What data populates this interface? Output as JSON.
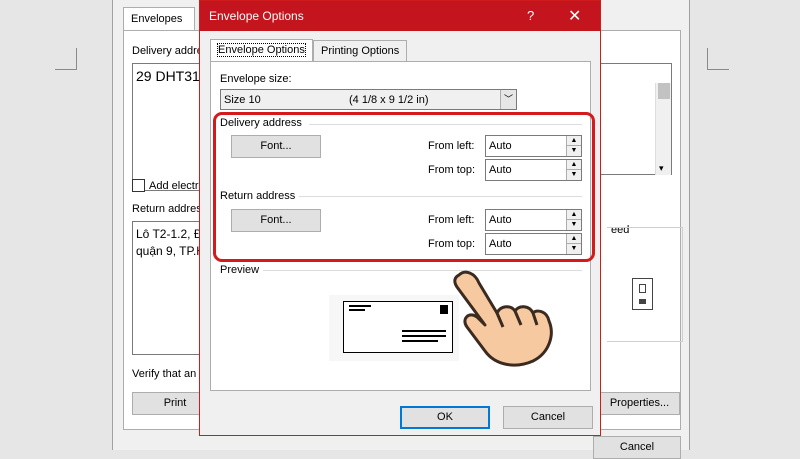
{
  "back_dialog": {
    "tab": "Envelopes",
    "delivery_label": "Delivery addre",
    "delivery_text": "29 DHT31,",
    "add_electronic": "Add electro",
    "return_label": "Return addres",
    "return_line1": "Lô T2-1.2, Đ",
    "return_line2": "quận 9, TP.H",
    "feed_label": "eed",
    "verify_text": "Verify that an e",
    "print_label": "Print",
    "properties_label": "Properties...",
    "cancel_label": "Cancel"
  },
  "envelope_options": {
    "title": "Envelope Options",
    "help": "?",
    "close": "✕",
    "tabs": [
      "Envelope Options",
      "Printing Options"
    ],
    "envelope_size_label": "Envelope size:",
    "envelope_size_value": "Size 10",
    "envelope_size_dims": "(4 1/8 x 9 1/2 in)",
    "delivery_group": {
      "title": "Delivery address",
      "font_button": "Font...",
      "from_left_label": "From left:",
      "from_left_value": "Auto",
      "from_top_label": "From top:",
      "from_top_value": "Auto"
    },
    "return_group": {
      "title": "Return address",
      "font_button": "Font...",
      "from_left_label": "From left:",
      "from_left_value": "Auto",
      "from_top_label": "From top:",
      "from_top_value": "Auto"
    },
    "preview_label": "Preview",
    "ok_label": "OK",
    "cancel_label": "Cancel"
  },
  "colors": {
    "title_bar": "#c4141d",
    "highlight": "#d41a1a",
    "default_button_border": "#0078d7"
  },
  "icons": [
    "help-icon",
    "close-icon",
    "chevron-down-icon",
    "spin-up-icon",
    "spin-down-icon",
    "pointing-hand-icon",
    "envelope-feed-icon"
  ]
}
